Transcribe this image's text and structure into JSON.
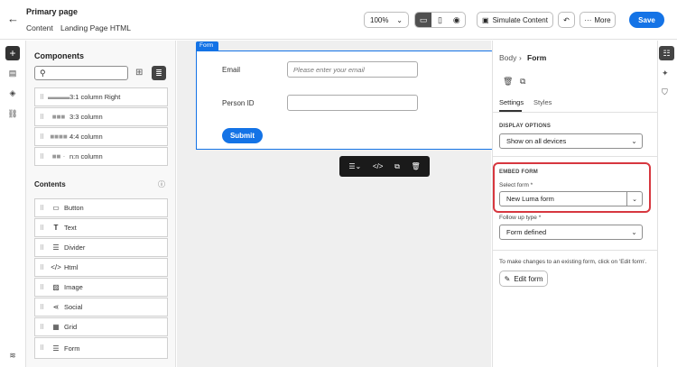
{
  "header": {
    "title": "Primary page",
    "breadcrumb": [
      "Content",
      "Landing Page HTML"
    ],
    "zoom": "100%",
    "simulate_label": "Simulate Content",
    "more_label": "More",
    "save_label": "Save"
  },
  "components": {
    "title": "Components",
    "layout_items": [
      "3:1 column Right",
      "3:3 column",
      "4:4 column",
      "n:n column"
    ],
    "contents_title": "Contents",
    "content_items": [
      "Button",
      "Text",
      "Divider",
      "Html",
      "Image",
      "Social",
      "Grid",
      "Form"
    ]
  },
  "canvas": {
    "form_tag": "Form",
    "email_label": "Email",
    "email_placeholder": "Please enter your email",
    "person_label": "Person ID",
    "submit_label": "Submit"
  },
  "properties": {
    "breadcrumb_parent": "Body",
    "breadcrumb_current": "Form",
    "tab_settings": "Settings",
    "tab_styles": "Styles",
    "display_options_title": "DISPLAY OPTIONS",
    "display_value": "Show on all devices",
    "embed_form_title": "EMBED FORM",
    "select_form_label": "Select form",
    "select_form_value": "New Luma form",
    "follow_up_label": "Follow up type",
    "follow_up_value": "Form defined",
    "edit_hint": "To make changes to an existing form, click on 'Edit form'.",
    "edit_button": "Edit form"
  },
  "colors": {
    "accent": "#1473e6",
    "highlight": "#d7373f"
  }
}
